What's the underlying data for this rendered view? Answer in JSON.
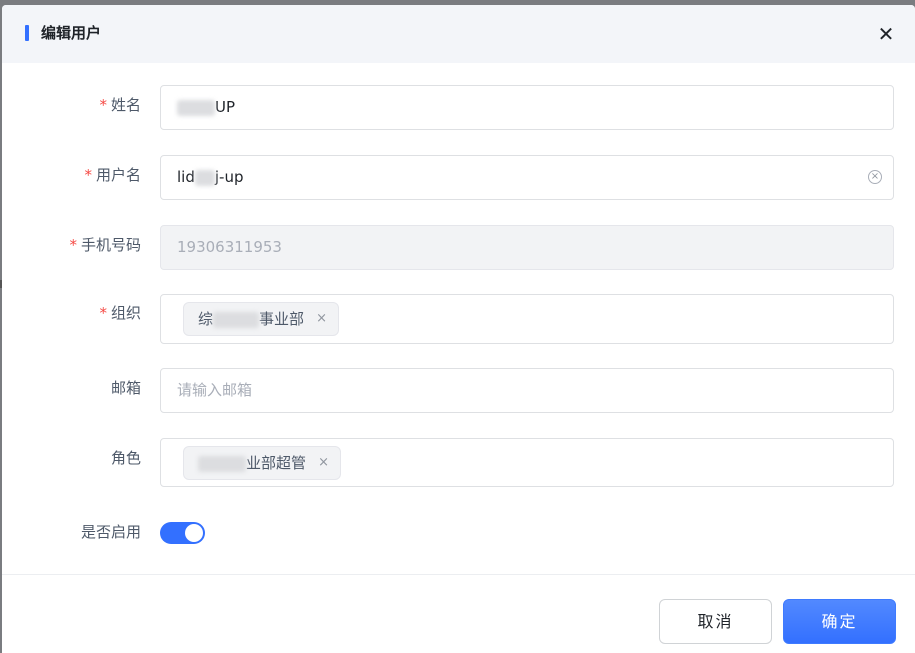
{
  "dialog": {
    "title": "编辑用户",
    "close_icon": "close-icon"
  },
  "form": {
    "name": {
      "label": "姓名",
      "required_mark": "*",
      "value_suffix": "UP"
    },
    "username": {
      "label": "用户名",
      "required_mark": "*",
      "value_prefix": "lid",
      "value_suffix": "j-up"
    },
    "phone": {
      "label": "手机号码",
      "required_mark": "*",
      "value": "19306311953"
    },
    "org": {
      "label": "组织",
      "required_mark": "*",
      "tag_prefix": "综",
      "tag_suffix": "事业部",
      "tag_remove": "×"
    },
    "email": {
      "label": "邮箱",
      "placeholder": "请输入邮箱"
    },
    "role": {
      "label": "角色",
      "tag_suffix": "业部超管",
      "tag_remove": "×"
    },
    "enabled": {
      "label": "是否启用",
      "value": true
    }
  },
  "footer": {
    "cancel_label": "取消",
    "ok_label": "确定"
  },
  "colors": {
    "accent": "#3370ff",
    "required": "#f54a45"
  }
}
